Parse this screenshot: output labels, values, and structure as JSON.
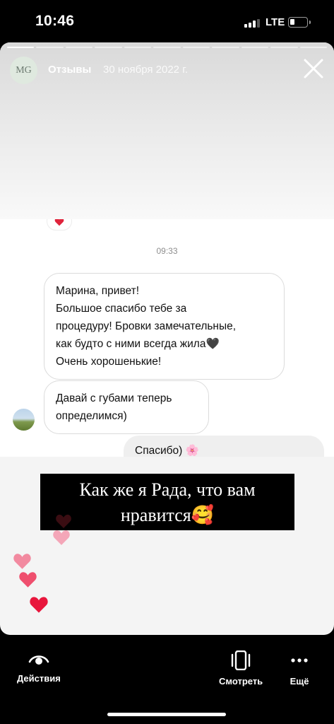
{
  "status_bar": {
    "time": "10:46",
    "network": "LTE",
    "battery_level": 0.25
  },
  "story": {
    "progress": {
      "segments": 11,
      "completed": 1
    },
    "header": {
      "avatar_monogram": "MG",
      "title": "Отзывы",
      "date": "30 ноября 2022 г."
    },
    "chat": {
      "reaction_icon": "heart-icon",
      "time": "09:33",
      "messages": [
        {
          "lines": [
            "Марина, привет!",
            "Большое спасибо тебе за",
            "процедуру! Бровки замечательные,",
            "как будто с ними всегда жила🖤",
            "Очень хорошенькие!"
          ]
        },
        {
          "lines": [
            "Давай с губами теперь",
            "определимся)"
          ]
        }
      ],
      "reply": "Спасибо) 🌸"
    },
    "caption": {
      "line1": "Как же я Рада, что вам",
      "line2": "нравится🥰"
    },
    "hearts_colors": [
      "#3a0d12",
      "#f4a6b8",
      "#f28aa0",
      "#ef4f6e",
      "#e8163c"
    ]
  },
  "bottom_bar": {
    "actions_label": "Действия",
    "view_label": "Смотреть",
    "more_label": "Ещё"
  }
}
